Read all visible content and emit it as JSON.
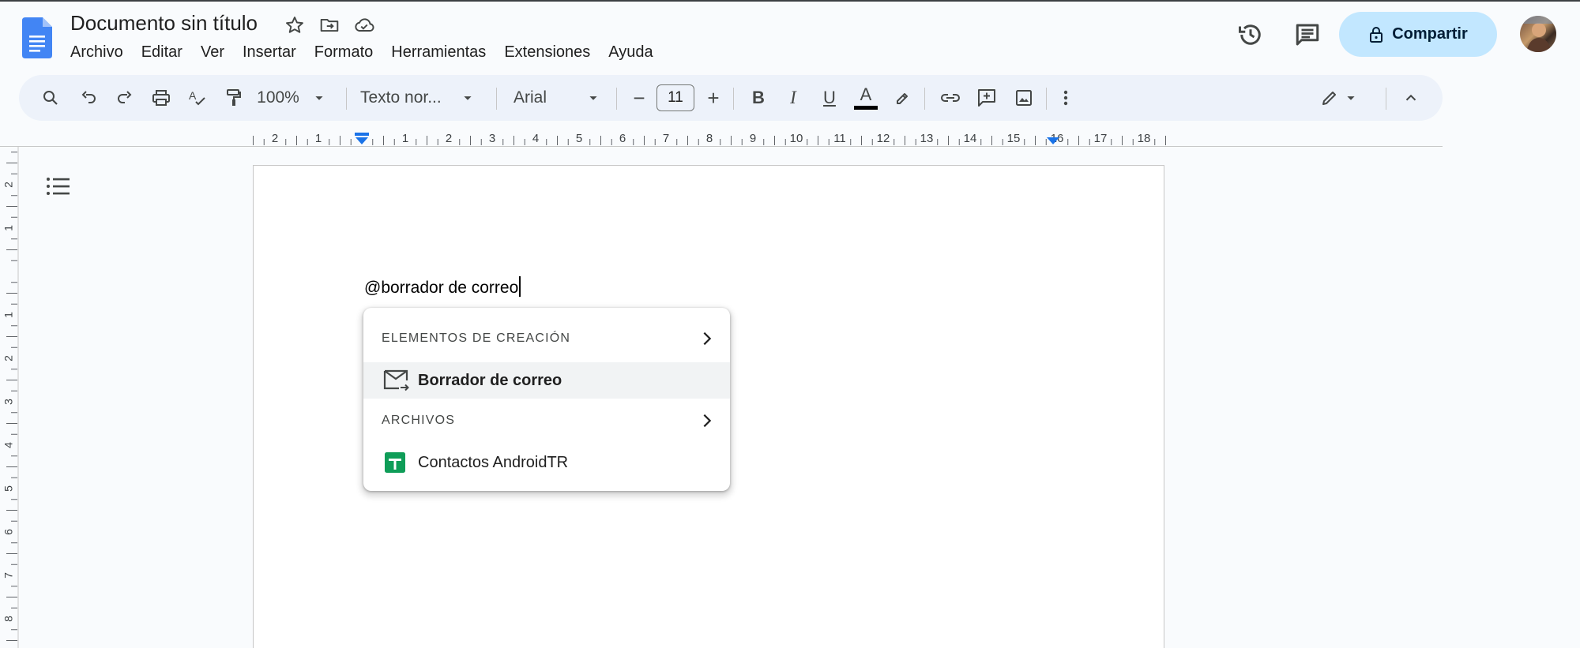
{
  "document": {
    "title": "Documento sin título",
    "body_text": "@borrador de correo"
  },
  "menu": [
    "Archivo",
    "Editar",
    "Ver",
    "Insertar",
    "Formato",
    "Herramientas",
    "Extensiones",
    "Ayuda"
  ],
  "header": {
    "share_label": "Compartir",
    "icons": [
      "star-icon",
      "move-to-folder-icon",
      "cloud-saved-icon",
      "history-icon",
      "comment-icon",
      "lock-icon"
    ]
  },
  "toolbar": {
    "zoom": "100%",
    "style": "Texto nor...",
    "font": "Arial",
    "font_size": "11",
    "minus": "−",
    "plus": "+",
    "bold": "B",
    "italic": "I",
    "underline": "U",
    "text_color": "A",
    "text_color_hex": "#000000"
  },
  "ruler": {
    "labels": [
      "2",
      "1",
      "1",
      "2",
      "3",
      "4",
      "5",
      "6",
      "7",
      "8",
      "9",
      "10",
      "11",
      "12",
      "13",
      "14",
      "15",
      "16",
      "17",
      "18"
    ],
    "vertical_labels": [
      "2",
      "1",
      "1",
      "2",
      "3",
      "4",
      "5",
      "6",
      "7",
      "8"
    ]
  },
  "popup": {
    "section1": "ELEMENTOS DE CREACIÓN",
    "item1": "Borrador de correo",
    "section2": "ARCHIVOS",
    "item2": "Contactos AndroidTR"
  },
  "colors": {
    "accent": "#c2e7ff",
    "toolbar_bg": "#edf2fa",
    "docs_blue": "#4285f4",
    "sheets_green": "#0f9d58"
  }
}
